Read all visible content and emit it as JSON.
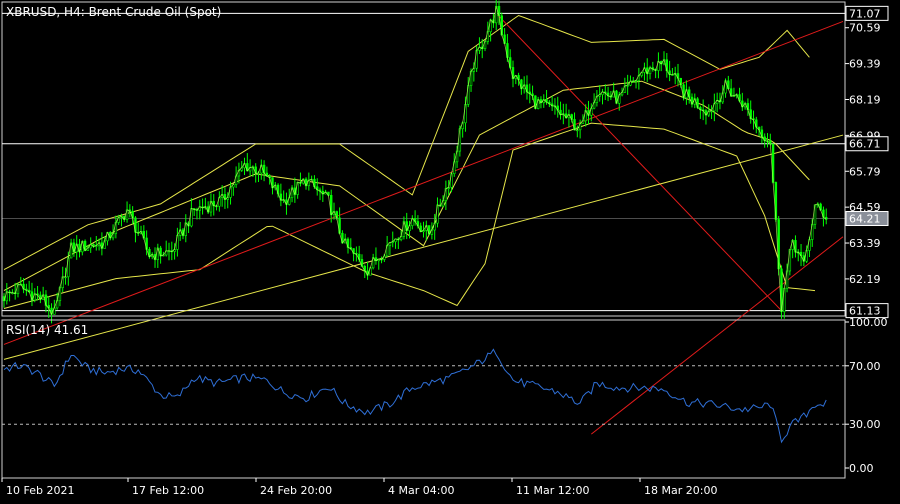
{
  "header": {
    "main_title": "XBRUSD, H4:  Brent Crude Oil (Spot)",
    "rsi_title": "RSI(14) 41.61"
  },
  "colors": {
    "background": "#000000",
    "candle": "#00ff00",
    "close_line": "#ccff66",
    "bollinger": "#e6e64a",
    "channel": "#e01b1b",
    "trendline_yellow": "#e6e64a",
    "rsi_line": "#2f6fd6",
    "levels": "#ffffff",
    "axis_text": "#ffffff"
  },
  "chart_data": [
    {
      "type": "candlestick",
      "symbol": "XBRUSD",
      "timeframe": "H4",
      "title": "XBRUSD, H4:  Brent Crude Oil (Spot)",
      "y_ticks": [
        "70.59",
        "69.39",
        "68.19",
        "66.99",
        "65.79",
        "64.59",
        "63.39",
        "62.19"
      ],
      "ylim": [
        60.95,
        71.45
      ],
      "x_ticks": [
        "10 Feb 2021",
        "17 Feb 12:00",
        "24 Feb 20:00",
        "4 Mar 04:00",
        "11 Mar 12:00",
        "18 Mar 20:00"
      ],
      "horizontal_levels": [
        {
          "label": "71.07",
          "value": 71.07
        },
        {
          "label": "66.71",
          "value": 66.71
        },
        {
          "label": "64.21",
          "value": 64.21,
          "current_price": true
        },
        {
          "label": "61.13",
          "value": 61.13
        }
      ],
      "price_path": [
        [
          0,
          61.6
        ],
        [
          6,
          61.9
        ],
        [
          10,
          61.7
        ],
        [
          14,
          61.5
        ],
        [
          18,
          61.0
        ],
        [
          24,
          63.2
        ],
        [
          30,
          63.3
        ],
        [
          36,
          63.4
        ],
        [
          44,
          64.5
        ],
        [
          52,
          63.0
        ],
        [
          60,
          63.1
        ],
        [
          68,
          64.5
        ],
        [
          78,
          64.8
        ],
        [
          86,
          66.0
        ],
        [
          92,
          65.8
        ],
        [
          100,
          64.8
        ],
        [
          108,
          65.5
        ],
        [
          116,
          64.8
        ],
        [
          122,
          63.3
        ],
        [
          130,
          62.5
        ],
        [
          138,
          63.4
        ],
        [
          146,
          64.2
        ],
        [
          152,
          63.7
        ],
        [
          160,
          65.7
        ],
        [
          168,
          69.4
        ],
        [
          176,
          71.15
        ],
        [
          182,
          69.0
        ],
        [
          190,
          68.1
        ],
        [
          198,
          67.8
        ],
        [
          206,
          67.2
        ],
        [
          212,
          68.5
        ],
        [
          220,
          68.2
        ],
        [
          228,
          69.1
        ],
        [
          236,
          69.4
        ],
        [
          244,
          68.3
        ],
        [
          252,
          67.8
        ],
        [
          258,
          68.6
        ],
        [
          264,
          68.1
        ],
        [
          270,
          67.2
        ],
        [
          274,
          66.8
        ],
        [
          278,
          61.3
        ],
        [
          282,
          63.5
        ],
        [
          286,
          62.6
        ],
        [
          290,
          64.6
        ],
        [
          294,
          64.3
        ]
      ],
      "bollinger_bands": {
        "upper": [
          [
            0,
            62.5
          ],
          [
            30,
            64.0
          ],
          [
            56,
            64.7
          ],
          [
            90,
            66.7
          ],
          [
            120,
            66.7
          ],
          [
            146,
            65.0
          ],
          [
            166,
            69.8
          ],
          [
            184,
            71.0
          ],
          [
            210,
            70.1
          ],
          [
            236,
            70.2
          ],
          [
            256,
            69.2
          ],
          [
            270,
            69.6
          ],
          [
            280,
            70.5
          ],
          [
            288,
            69.6
          ]
        ],
        "middle": [
          [
            0,
            61.8
          ],
          [
            40,
            63.8
          ],
          [
            90,
            65.7
          ],
          [
            120,
            65.3
          ],
          [
            150,
            63.3
          ],
          [
            170,
            67.0
          ],
          [
            200,
            68.5
          ],
          [
            228,
            68.8
          ],
          [
            250,
            68.0
          ],
          [
            265,
            67.1
          ],
          [
            275,
            66.8
          ],
          [
            288,
            65.5
          ]
        ],
        "lower": [
          [
            0,
            61.2
          ],
          [
            40,
            62.2
          ],
          [
            70,
            62.5
          ],
          [
            95,
            64.0
          ],
          [
            130,
            62.4
          ],
          [
            150,
            61.8
          ],
          [
            162,
            61.3
          ],
          [
            172,
            62.7
          ],
          [
            182,
            66.5
          ],
          [
            210,
            67.4
          ],
          [
            236,
            67.2
          ],
          [
            262,
            66.3
          ],
          [
            272,
            64.3
          ],
          [
            280,
            61.9
          ],
          [
            290,
            61.8
          ]
        ]
      },
      "overlays": [
        {
          "kind": "trendline",
          "color": "red",
          "from": [
            0,
            60.0
          ],
          "to": [
            300,
            70.8
          ]
        },
        {
          "kind": "trendline",
          "color": "red",
          "from": [
            210,
            57.0
          ],
          "to": [
            300,
            63.6
          ]
        },
        {
          "kind": "trendline",
          "color": "red",
          "from": [
            176,
            71.07
          ],
          "to": [
            278,
            61.13
          ]
        },
        {
          "kind": "trendline",
          "color": "yellow",
          "from": [
            0,
            59.5
          ],
          "to": [
            300,
            67.0
          ]
        }
      ]
    },
    {
      "type": "line",
      "name": "RSI(14)",
      "current_value": "41.61",
      "y_ticks": [
        "100.00",
        "70.00",
        "30.00",
        "0.00"
      ],
      "ylim": [
        0,
        100
      ],
      "levels": [
        70,
        30
      ],
      "values": [
        [
          0,
          68
        ],
        [
          6,
          70
        ],
        [
          12,
          65
        ],
        [
          18,
          56
        ],
        [
          24,
          78
        ],
        [
          30,
          68
        ],
        [
          36,
          65
        ],
        [
          42,
          68
        ],
        [
          48,
          67
        ],
        [
          56,
          50
        ],
        [
          62,
          48
        ],
        [
          68,
          62
        ],
        [
          76,
          58
        ],
        [
          86,
          62
        ],
        [
          94,
          60
        ],
        [
          100,
          52
        ],
        [
          108,
          48
        ],
        [
          116,
          56
        ],
        [
          122,
          44
        ],
        [
          130,
          38
        ],
        [
          138,
          44
        ],
        [
          146,
          55
        ],
        [
          152,
          58
        ],
        [
          160,
          62
        ],
        [
          168,
          70
        ],
        [
          176,
          80
        ],
        [
          182,
          60
        ],
        [
          190,
          56
        ],
        [
          198,
          52
        ],
        [
          206,
          44
        ],
        [
          212,
          58
        ],
        [
          220,
          55
        ],
        [
          228,
          55
        ],
        [
          236,
          54
        ],
        [
          244,
          45
        ],
        [
          252,
          44
        ],
        [
          258,
          42
        ],
        [
          264,
          40
        ],
        [
          270,
          41
        ],
        [
          274,
          44
        ],
        [
          278,
          20
        ],
        [
          282,
          30
        ],
        [
          286,
          35
        ],
        [
          290,
          44
        ],
        [
          294,
          44
        ]
      ]
    }
  ]
}
